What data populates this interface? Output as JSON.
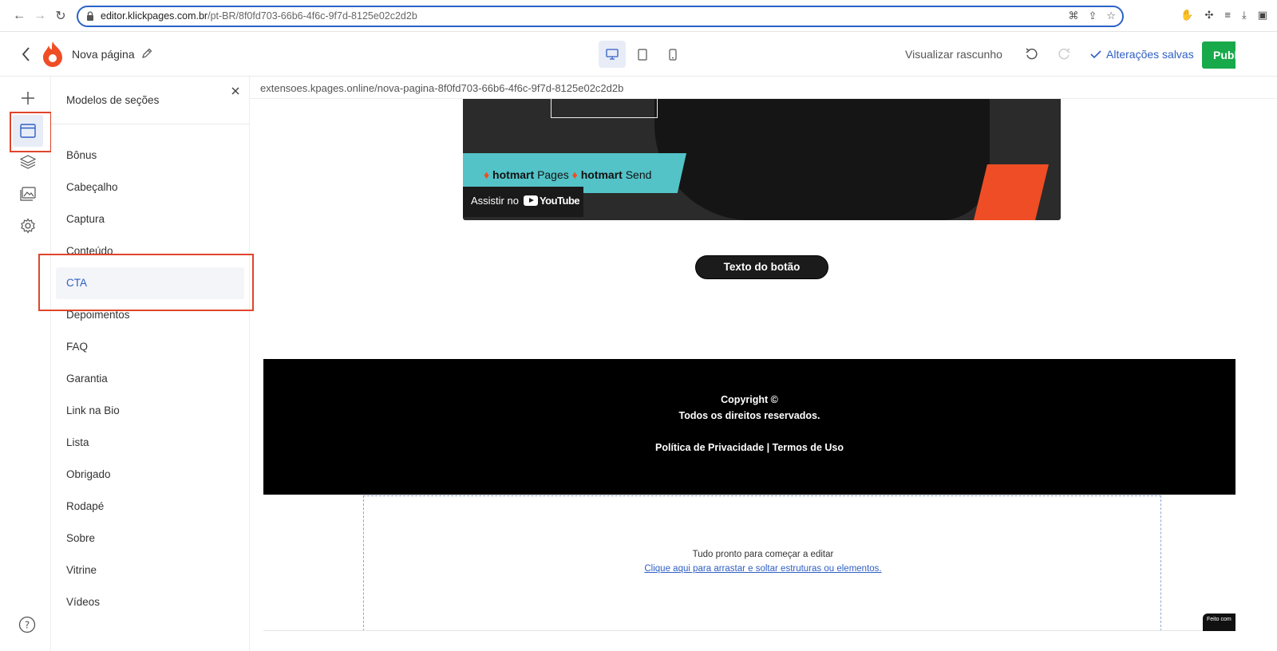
{
  "browser": {
    "url_host": "editor.klickpages.com.br",
    "url_path": "/pt-BR/8f0fd703-66b6-4f6c-9f7d-8125e02c2d2b"
  },
  "header": {
    "page_name": "Nova página",
    "preview_label": "Visualizar rascunho",
    "saved_label": "Alterações salvas",
    "publish_label": "Publicar",
    "accent_color": "#2f5fc4",
    "publish_color": "#18a94a"
  },
  "panel": {
    "title": "Modelos de seções",
    "items": [
      "Bônus",
      "Cabeçalho",
      "Captura",
      "Conteúdo",
      "CTA",
      "Depoimentos",
      "FAQ",
      "Garantia",
      "Link na Bio",
      "Lista",
      "Obrigado",
      "Rodapé",
      "Sobre",
      "Vitrine",
      "Vídeos"
    ],
    "selected": "CTA"
  },
  "canvas": {
    "url": "extensoes.kpages.online/nova-pagina-8f0fd703-66b6-4f6c-9f7d-8125e02c2d2b",
    "video": {
      "brand1": "hotmart",
      "product1": "Pages",
      "brand2": "hotmart",
      "product2": "Send",
      "watch_on": "Assistir no",
      "youtube": "YouTube"
    },
    "cta_button": "Texto do botão",
    "footer": {
      "copyright": "Copyright ©",
      "rights": "Todos os direitos reservados.",
      "links": "Política de Privacidade | Termos de Uso"
    },
    "drop_zone": {
      "title": "Tudo pronto para começar a editar",
      "link": "Clique aqui para arrastar e soltar estruturas ou elementos."
    },
    "made_with": "Feito com"
  },
  "highlight_color": "#e0452c"
}
